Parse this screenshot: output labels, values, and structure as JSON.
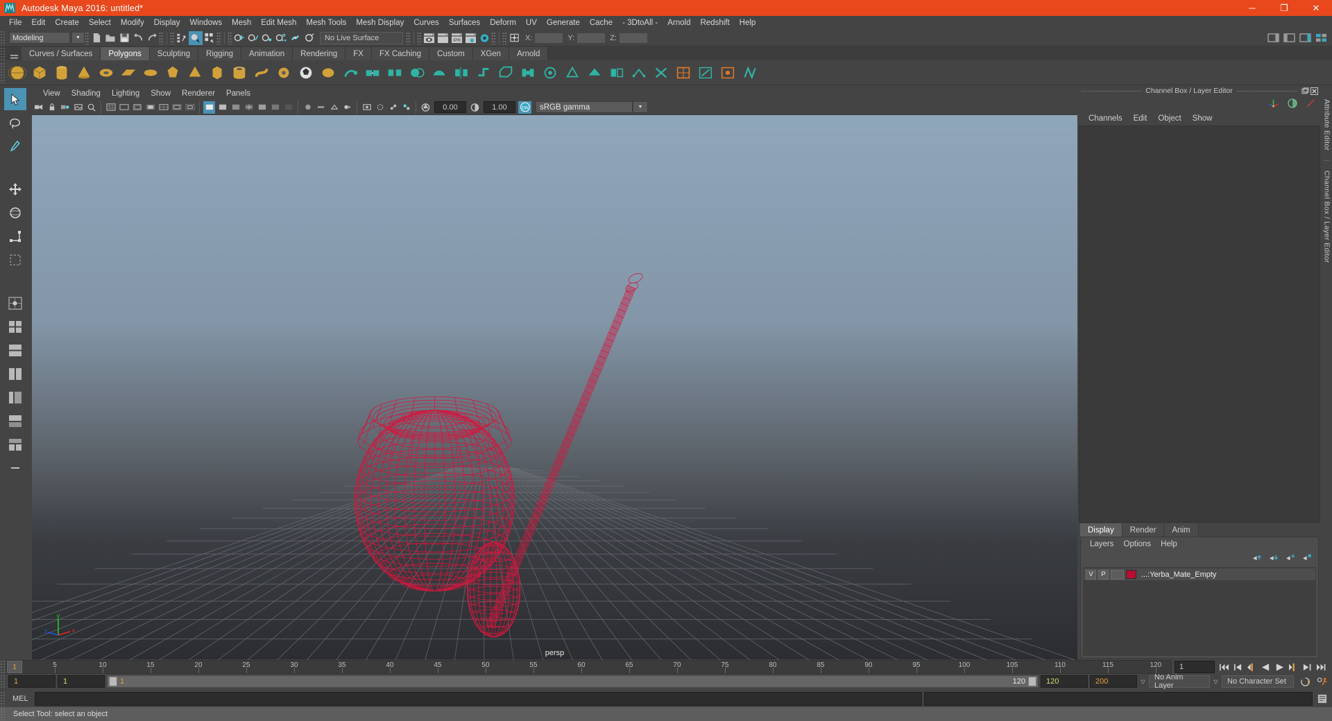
{
  "window": {
    "title": "Autodesk Maya 2016: untitled*",
    "logo_icon": "maya-logo-icon",
    "minimize_label": "─",
    "maximize_label": "❐",
    "close_label": "✕"
  },
  "menubar": {
    "items": [
      "File",
      "Edit",
      "Create",
      "Select",
      "Modify",
      "Display",
      "Windows",
      "Mesh",
      "Edit Mesh",
      "Mesh Tools",
      "Mesh Display",
      "Curves",
      "Surfaces",
      "Deform",
      "UV",
      "Generate",
      "Cache",
      "- 3DtoAll -",
      "Arnold",
      "Redshift",
      "Help"
    ]
  },
  "statusbar": {
    "menuset": "Modeling",
    "menuset_arrow": "▼",
    "live_surface": "No Live Surface",
    "x_label": "X:",
    "y_label": "Y:",
    "z_label": "Z:",
    "x_value": "",
    "y_value": "",
    "z_value": "",
    "icons": [
      "new-scene-icon",
      "open-scene-icon",
      "save-scene-icon",
      "undo-icon",
      "redo-icon",
      "select-hierarchy-icon",
      "select-object-icon",
      "select-component-icon",
      "snap-grid-icon",
      "snap-curve-icon",
      "snap-point-icon",
      "snap-projected-icon",
      "snap-view-plane-icon",
      "make-live-icon",
      "render-view-icon",
      "render-region-icon",
      "ipr-render-icon",
      "render-settings-icon",
      "hypershade-icon",
      "input-output-icon"
    ]
  },
  "shelf": {
    "tabs": [
      "Curves / Surfaces",
      "Polygons",
      "Sculpting",
      "Rigging",
      "Animation",
      "Rendering",
      "FX",
      "FX Caching",
      "Custom",
      "XGen",
      "Arnold"
    ],
    "active_tab": "Polygons",
    "icons": [
      "poly-sphere-icon",
      "poly-cube-icon",
      "poly-cylinder-icon",
      "poly-cone-icon",
      "poly-torus-icon",
      "poly-plane-icon",
      "poly-disc-icon",
      "poly-platonic-icon",
      "poly-pyramid-icon",
      "poly-prism-icon",
      "poly-pipe-icon",
      "poly-helix-icon",
      "poly-gear-icon",
      "poly-soccerball-icon",
      "poly-superellipse-icon",
      "sculpt-geometry-icon",
      "combine-icon",
      "separate-icon",
      "booleans-icon",
      "smooth-icon",
      "mirror-geometry-icon",
      "extrude-icon",
      "bevel-icon",
      "bridge-icon",
      "fill-hole-icon",
      "append-polygon-icon",
      "wedge-face-icon",
      "duplicate-face-icon",
      "connect-icon",
      "detach-icon",
      "merge-vertex-icon",
      "multi-cut-icon",
      "target-weld-icon",
      "quad-draw-icon"
    ]
  },
  "lefttools": {
    "items": [
      {
        "name": "select-tool",
        "selected": true
      },
      {
        "name": "lasso-select-tool",
        "selected": false
      },
      {
        "name": "paint-select-tool",
        "selected": false
      },
      {
        "name": "move-tool",
        "selected": false
      },
      {
        "name": "rotate-tool",
        "selected": false
      },
      {
        "name": "scale-tool",
        "selected": false
      },
      {
        "name": "last-tool-used",
        "selected": false
      },
      {
        "name": "single-perspective-layout",
        "selected": false
      },
      {
        "name": "four-view-layout",
        "selected": false
      },
      {
        "name": "two-pane-stacked-layout",
        "selected": false
      },
      {
        "name": "two-pane-side-layout",
        "selected": false
      },
      {
        "name": "persp-outliner-layout",
        "selected": false
      },
      {
        "name": "persp-graph-layout",
        "selected": false
      },
      {
        "name": "hypershade-layout",
        "selected": false
      },
      {
        "name": "persp-hypergraph-layout",
        "selected": false
      }
    ]
  },
  "viewport": {
    "menus": [
      "View",
      "Shading",
      "Lighting",
      "Show",
      "Renderer",
      "Panels"
    ],
    "camera_label": "persp",
    "exposure_value": "0.00",
    "gamma_value": "1.00",
    "color_management_toggle": "ON",
    "color_profile": "sRGB gamma",
    "color_profile_arrow": "▼",
    "axis_x": "x",
    "axis_y": "y",
    "axis_z": "z",
    "axis_x_color": "#ee2222",
    "axis_y_color": "#22cc22",
    "axis_z_color": "#2255ee",
    "wireframe_color": "#d2183f",
    "toolbar_icons": [
      "select-camera-icon",
      "lock-camera-icon",
      "camera-attributes-icon",
      "image-plane-icon",
      "two-dimensional-pan-zoom-icon",
      "grid-toggle-icon",
      "film-gate-icon",
      "resolution-gate-icon",
      "gate-mask-icon",
      "field-chart-icon",
      "safe-action-icon",
      "safe-title-icon",
      "wireframe-icon",
      "smooth-shade-all-icon",
      "smooth-shade-selected-icon",
      "wireframe-on-shaded-icon",
      "texture-toggle-icon",
      "lighting-toggle-icon",
      "shadows-icon",
      "screen-space-ao-icon",
      "motion-blur-icon",
      "multisample-icon",
      "depth-of-field-icon",
      "isolate-select-icon",
      "xray-icon",
      "xray-joints-icon",
      "xray-active-components-icon",
      "exposure-icon",
      "gamma-icon",
      "color-management-icon"
    ]
  },
  "channelbox": {
    "title": "Channel Box / Layer Editor",
    "undock_icon": "undock-icon",
    "close_icon": "close-icon",
    "tool_icons": [
      "channel-box-icon",
      "attribute-editor-icon",
      "modeling-toolkit-icon"
    ],
    "menus": [
      "Channels",
      "Edit",
      "Object",
      "Show"
    ]
  },
  "layereditor": {
    "tabs": [
      "Display",
      "Render",
      "Anim"
    ],
    "active_tab": "Display",
    "menus": [
      "Layers",
      "Options",
      "Help"
    ],
    "button_icons": [
      "move-layer-up-icon",
      "move-layer-down-icon",
      "new-layer-icon",
      "new-layer-from-selected-icon"
    ],
    "layers": [
      {
        "visibility": "V",
        "playback": "P",
        "state": "",
        "color": "#b50f32",
        "name": "...:Yerba_Mate_Empty"
      }
    ]
  },
  "sidetabs": {
    "items": [
      "Attribute Editor",
      "Channel Box / Layer Editor"
    ]
  },
  "timeline": {
    "tick_labels": [
      "5",
      "10",
      "15",
      "20",
      "25",
      "30",
      "35",
      "40",
      "45",
      "50",
      "55",
      "60",
      "65",
      "70",
      "75",
      "80",
      "85",
      "90",
      "95",
      "100",
      "105",
      "110",
      "115",
      "120"
    ],
    "tick_values": [
      5,
      10,
      15,
      20,
      25,
      30,
      35,
      40,
      45,
      50,
      55,
      60,
      65,
      70,
      75,
      80,
      85,
      90,
      95,
      100,
      105,
      110,
      115,
      120
    ],
    "range_start": 1,
    "range_end": 120,
    "current_frame": "1",
    "current_frame_field": "1",
    "playback_icons": [
      "go-to-start-icon",
      "step-back-keyframe-icon",
      "step-back-frame-icon",
      "play-backwards-icon",
      "play-forwards-icon",
      "step-forward-frame-icon",
      "step-forward-keyframe-icon",
      "go-to-end-icon"
    ]
  },
  "rangeslider": {
    "anim_start": "1",
    "range_start": "1",
    "slider_start_label": "1",
    "slider_end_label": "120",
    "range_end": "120",
    "anim_end": "200",
    "anim_layer": "No Anim Layer",
    "character_set": "No Character Set",
    "anim_layer_arrow": "▽",
    "character_set_arrow": "▽",
    "auto_keyframe_icon": "auto-keyframe-icon",
    "animation_preferences_icon": "animation-preferences-icon"
  },
  "commandline": {
    "language_label": "MEL",
    "input_value": "",
    "output_value": ""
  },
  "statusline": {
    "message": "Select Tool: select an object",
    "help_icon": "help-line-icon"
  },
  "colors": {
    "title_bar": "#e8481c",
    "panel_bg": "#444444",
    "accent_blue": "#4a93b5",
    "accent_orange": "#e8a33d",
    "wireframe_red": "#d2183f"
  }
}
